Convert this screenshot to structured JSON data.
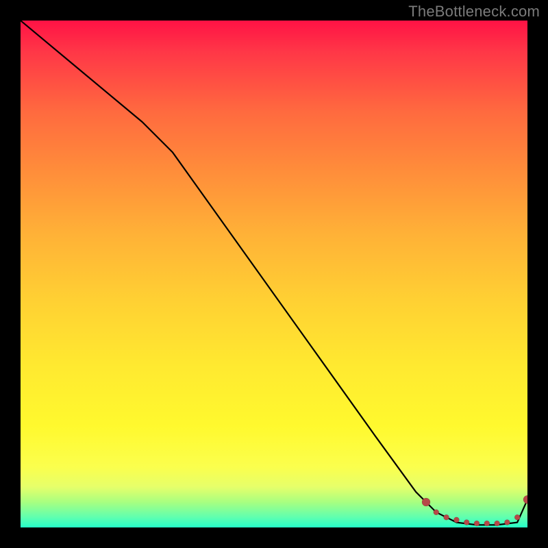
{
  "watermark": "TheBottleneck.com",
  "colors": {
    "background": "#000000",
    "curve": "#000000",
    "dots": "#b64848",
    "gradient_top": "#ff1245",
    "gradient_bottom": "#25ffc8"
  },
  "chart_data": {
    "type": "line",
    "title": "",
    "xlabel": "",
    "ylabel": "",
    "xlim": [
      0,
      100
    ],
    "ylim": [
      0,
      100
    ],
    "note": "No axis ticks or numeric labels are shown in the image; x/y values are normalized 0–100 estimates read from pixel positions.",
    "series": [
      {
        "name": "curve",
        "x": [
          0,
          12,
          24,
          30,
          40,
          50,
          60,
          70,
          78,
          82,
          86,
          90,
          94,
          98,
          100
        ],
        "y": [
          100,
          90,
          80,
          74,
          60,
          46,
          32,
          18,
          7,
          3,
          1,
          0.5,
          0.5,
          1,
          5.5
        ]
      }
    ],
    "dotted_segment": {
      "name": "bottom-dots",
      "x": [
        80,
        82,
        84,
        86,
        88,
        90,
        92,
        94,
        96,
        98,
        100
      ],
      "y": [
        5,
        3,
        2,
        1.5,
        1,
        0.8,
        0.8,
        0.8,
        1,
        2,
        5.5
      ]
    }
  }
}
